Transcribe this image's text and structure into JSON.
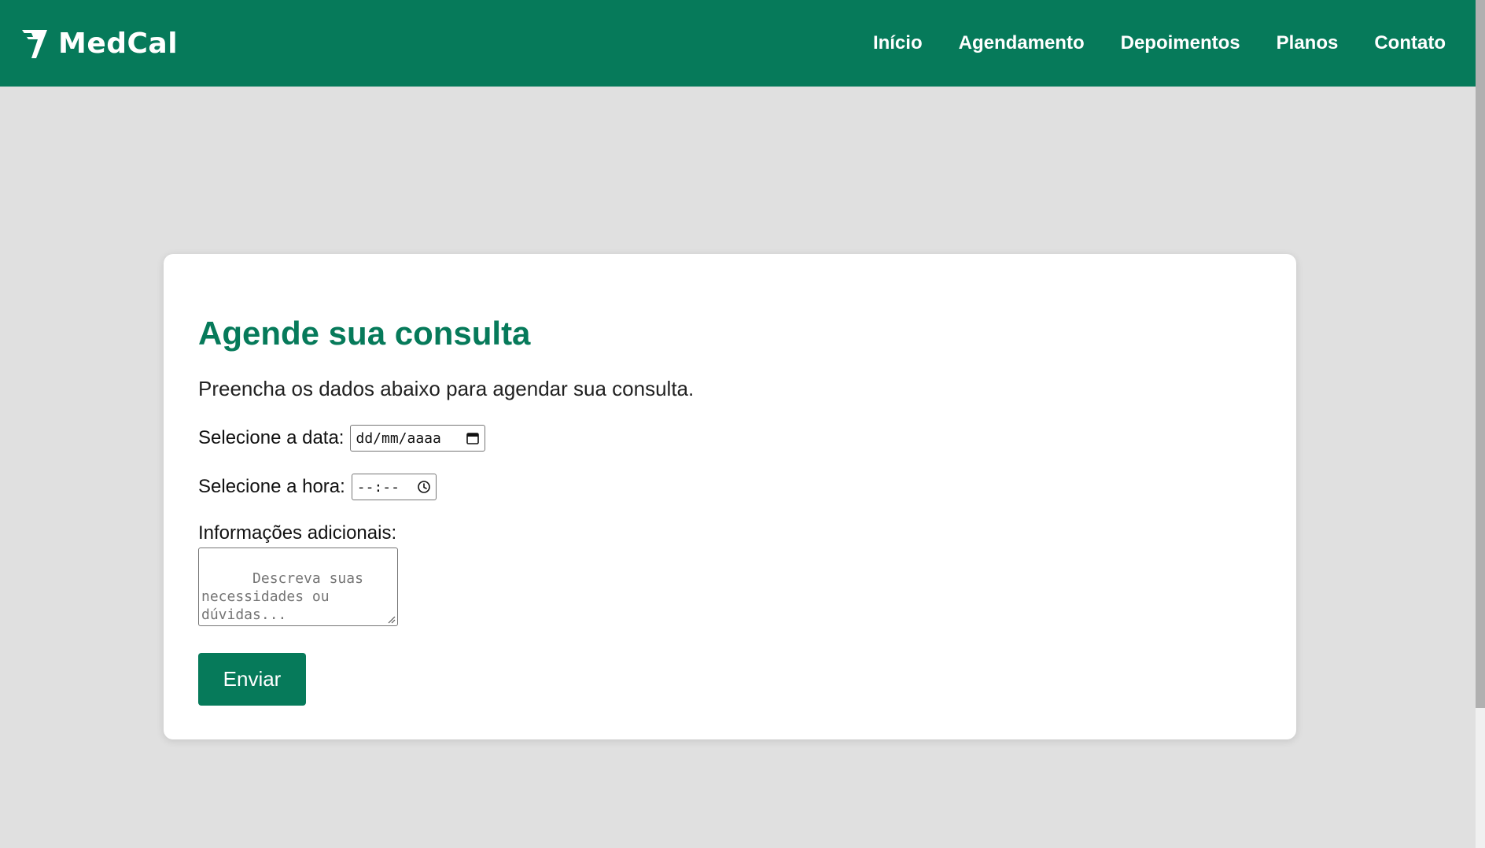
{
  "brand": {
    "name": "MedCal",
    "color": "#067a5a"
  },
  "nav": [
    {
      "label": "Início"
    },
    {
      "label": "Agendamento"
    },
    {
      "label": "Depoimentos"
    },
    {
      "label": "Planos"
    },
    {
      "label": "Contato"
    }
  ],
  "form": {
    "title": "Agende sua consulta",
    "subtitle": "Preencha os dados abaixo para agendar sua consulta.",
    "date_label": "Selecione a data:",
    "date_value": "dd/mm/aaaa",
    "time_label": "Selecione a hora:",
    "time_value": "--:--",
    "info_label": "Informações adicionais:",
    "info_placeholder": "Descreva suas\nnecessidades ou\ndúvidas...",
    "submit_label": "Enviar"
  },
  "icons": {
    "logo": "medcal-logo-icon",
    "calendar": "calendar-icon",
    "clock": "clock-icon"
  }
}
